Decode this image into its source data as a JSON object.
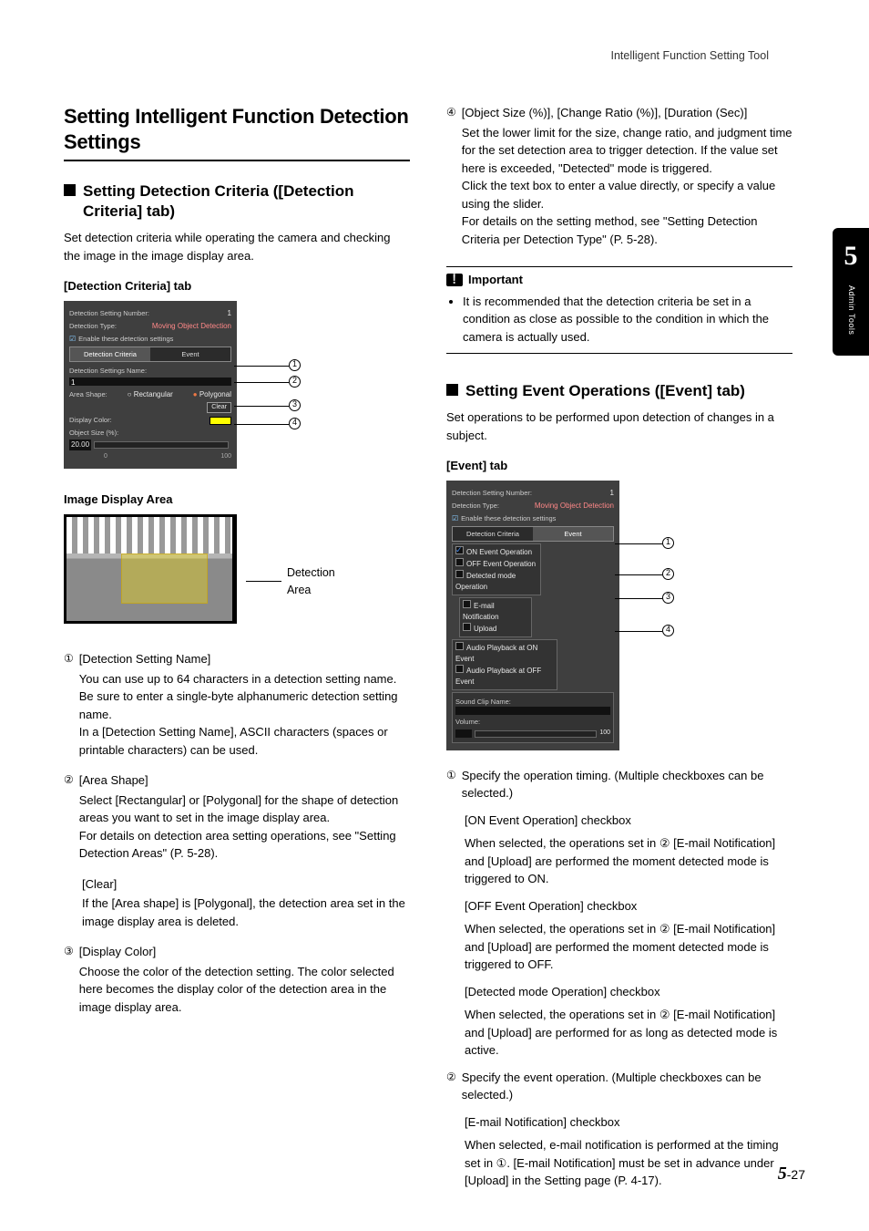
{
  "running_head": "Intelligent Function Setting Tool",
  "side_tab": {
    "num": "5",
    "label": "Admin Tools"
  },
  "main_heading": "Setting Intelligent Function Detection Settings",
  "left": {
    "h2": "Setting Detection Criteria ([Detection Criteria] tab)",
    "intro1": "Set detection criteria while operating the camera and checking the image in the image display area.",
    "tab_label": "[Detection Criteria] tab",
    "panel": {
      "num_label": "Detection Setting Number:",
      "num_val": "1",
      "type_label": "Detection Type:",
      "type_val": "Moving Object Detection",
      "enable": "Enable these detection settings",
      "tab_a": "Detection Criteria",
      "tab_b": "Event",
      "name_label": "Detection Settings Name:",
      "name_val": "1",
      "shape_label": "Area Shape:",
      "shape_rect": "Rectangular",
      "shape_poly": "Polygonal",
      "clear_btn": "Clear",
      "color_label": "Display Color:",
      "size_label": "Object Size (%):",
      "size_val": "20.00",
      "slider_min": "0",
      "slider_max": "100"
    },
    "img_area_h": "Image Display Area",
    "img_area_label": "Detection Area",
    "items": [
      {
        "num": "①",
        "title": "[Detection Setting Name]",
        "body": "You can use up to 64 characters in a detection setting name. Be sure to enter a single-byte alphanumeric detection setting name.\nIn a [Detection Setting Name], ASCII characters (spaces or printable characters) can be used."
      },
      {
        "num": "②",
        "title": "[Area Shape]",
        "body": "Select [Rectangular] or [Polygonal] for the shape of detection areas you want to set in the image display area.\nFor details on detection area setting operations, see \"Setting Detection Areas\" (P. 5-28)."
      },
      {
        "num": "",
        "title": "[Clear]",
        "body": "If the [Area shape] is [Polygonal], the detection area set in the image display area is deleted."
      },
      {
        "num": "③",
        "title": "[Display Color]",
        "body": "Choose the color of the detection setting. The color selected here becomes the display color of the detection area in the image display area."
      }
    ]
  },
  "right": {
    "item4": {
      "num": "④",
      "title": "[Object Size (%)], [Change Ratio (%)], [Duration (Sec)]",
      "body": "Set the lower limit for the size, change ratio, and judgment time for the set detection area to trigger detection. If the value set here is exceeded, \"Detected\" mode is triggered.\nClick the text box to enter a value directly, or specify a value using the slider.\nFor details on the setting method, see \"Setting Detection Criteria per Detection Type\" (P. 5-28)."
    },
    "important_h": "Important",
    "important_body": "It is recommended that the detection criteria be set in a condition as close as possible to the condition in which the camera is actually used.",
    "h2": "Setting Event Operations ([Event] tab)",
    "intro": "Set operations to be performed upon detection of changes in a subject.",
    "tab_label": "[Event] tab",
    "panel": {
      "num_label": "Detection Setting Number:",
      "num_val": "1",
      "type_label": "Detection Type:",
      "type_val": "Moving Object Detection",
      "enable": "Enable these detection settings",
      "tab_a": "Detection Criteria",
      "tab_b": "Event",
      "on_op": "ON Event Operation",
      "off_op": "OFF Event Operation",
      "detected_op": "Detected mode Operation",
      "email": "E-mail Notification",
      "upload": "Upload",
      "audio_on": "Audio Playback at ON Event",
      "audio_off": "Audio Playback at OFF Event",
      "clip_label": "Sound Clip Name:",
      "vol_label": "Volume:",
      "slider_max": "100"
    },
    "event_items": [
      {
        "num": "①",
        "lead": "Specify the operation timing. (Multiple checkboxes can be selected.)",
        "subs": [
          {
            "h": "[ON Event Operation] checkbox",
            "b": "When selected, the operations set in ② [E-mail Notification] and [Upload] are performed the moment detected mode is triggered to ON."
          },
          {
            "h": "[OFF Event Operation] checkbox",
            "b": "When selected, the operations set in ② [E-mail Notification] and [Upload] are performed the moment detected mode is triggered to OFF."
          },
          {
            "h": "[Detected mode Operation] checkbox",
            "b": "When selected, the operations set in ② [E-mail Notification] and [Upload] are performed for as long as detected mode is active."
          }
        ]
      },
      {
        "num": "②",
        "lead": "Specify the event operation. (Multiple checkboxes can be selected.)",
        "subs": [
          {
            "h": "[E-mail Notification] checkbox",
            "b": "When selected, e-mail notification is performed at the timing set in ①. [E-mail Notification] must be set in advance under [Upload] in the Setting page (P. 4-17)."
          }
        ]
      }
    ]
  },
  "page_num": {
    "chapter": "5",
    "sep": "-",
    "page": "27"
  }
}
